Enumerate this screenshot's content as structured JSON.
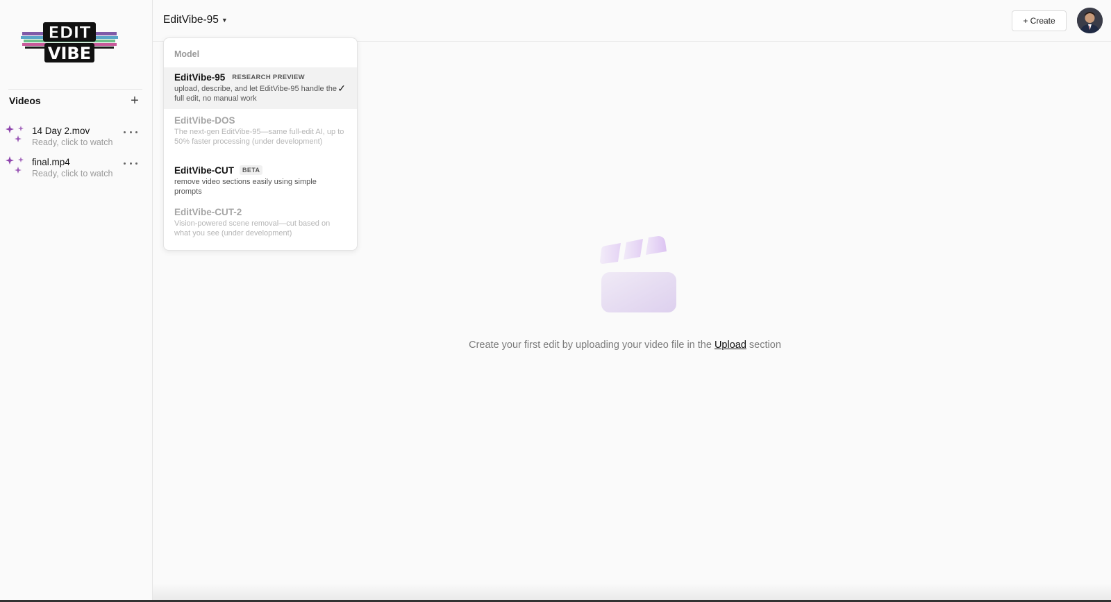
{
  "sidebar": {
    "logo_top": "EDIT",
    "logo_bottom": "VIBE",
    "videos_title": "Videos",
    "add_label": "+",
    "items": [
      {
        "name": "14 Day 2.mov",
        "status": "Ready, click to watch"
      },
      {
        "name": "final.mp4",
        "status": "Ready, click to watch"
      }
    ]
  },
  "topbar": {
    "model_selected": "EditVibe-95",
    "create_label": "+ Create"
  },
  "dropdown": {
    "label": "Model",
    "options": [
      {
        "name": "EditVibe-95",
        "badge": "RESEARCH PREVIEW",
        "desc": "upload, describe, and let EditVibe-95 handle the full edit, no manual work",
        "selected": true,
        "check": "✓"
      },
      {
        "name": "EditVibe-DOS",
        "badge": "",
        "desc": "The next-gen EditVibe-95—same full-edit AI, up to 50% faster processing (under development)",
        "disabled": true
      },
      {
        "name": "EditVibe-CUT",
        "badge": "BETA",
        "desc": "remove video sections easily using simple prompts"
      },
      {
        "name": "EditVibe-CUT-2",
        "badge": "",
        "desc": "Vision-powered scene removal—cut based on what you see (under development)",
        "disabled": true
      }
    ]
  },
  "empty_state": {
    "text_before": "Create your first edit by uploading your video file in the ",
    "link": "Upload",
    "text_after": " section"
  },
  "colors": {
    "accent_purple": "#9b59b6",
    "sparkle": "#8e44ad"
  }
}
